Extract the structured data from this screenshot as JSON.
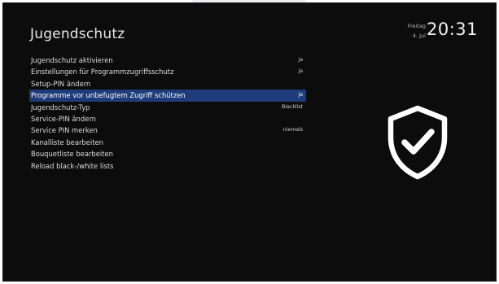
{
  "header": {
    "title": "Jugendschutz",
    "day": "Freitag",
    "date": "4. Jul",
    "time": "20:31"
  },
  "menu": {
    "items": [
      {
        "label": "Jugendschutz aktivieren",
        "value": "Ja"
      },
      {
        "label": "Einstellungen für Programmzugriffsschutz",
        "value": "Ja"
      },
      {
        "label": "Setup-PIN ändern",
        "value": ""
      },
      {
        "label": "Programme vor unbefugtem Zugriff schützen",
        "value": "Ja"
      },
      {
        "label": "Jugendschutz-Typ",
        "value": "Blacklist"
      },
      {
        "label": "Service-PIN ändern",
        "value": ""
      },
      {
        "label": "Service PIN merken",
        "value": "niemals"
      },
      {
        "label": "Kanalliste bearbeiten",
        "value": ""
      },
      {
        "label": "Bouquetliste bearbeiten",
        "value": ""
      },
      {
        "label": "Reload black-/white lists",
        "value": ""
      }
    ],
    "selected_index": 3
  },
  "icons": {
    "shield": "shield-check-icon"
  },
  "colors": {
    "background": "#0c0c0c",
    "selection": "#1e3b7a",
    "text": "#dcdcdc"
  }
}
